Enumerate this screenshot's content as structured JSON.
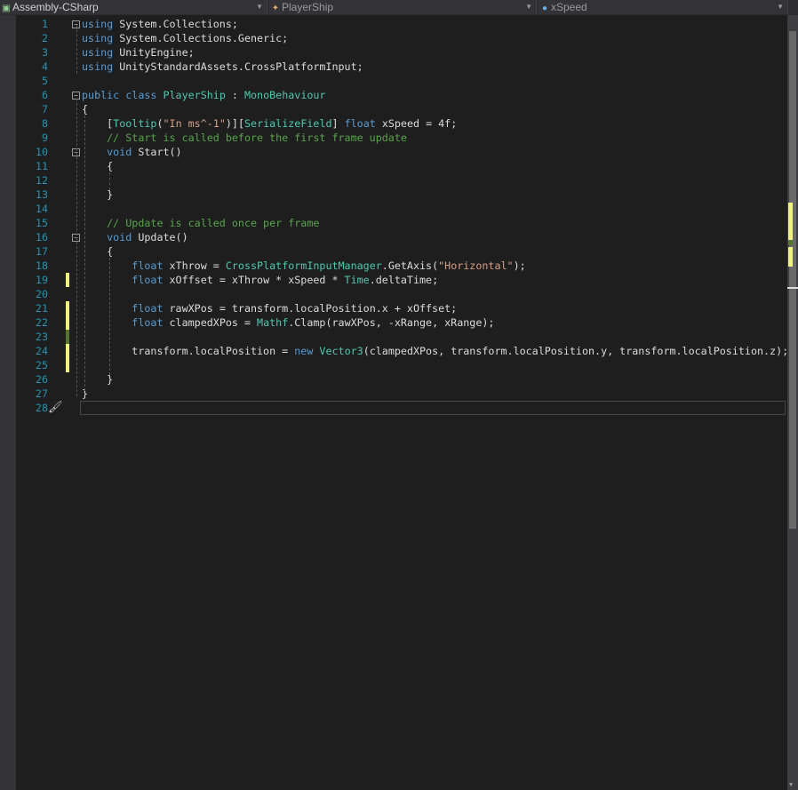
{
  "navbar": {
    "project": "Assembly-CSharp",
    "class": "PlayerShip",
    "member": "xSpeed",
    "project_icon": "csharp-project-icon",
    "class_icon": "class-icon",
    "member_icon": "field-icon"
  },
  "colors": {
    "background": "#1e1e1e",
    "line_number": "#2b91af",
    "keyword": "#569cd6",
    "type": "#4ec9b0",
    "string": "#d69d85",
    "comment": "#57a64a",
    "changed": "#eff283",
    "saved": "#577430"
  },
  "lines": [
    {
      "n": "1",
      "fold": "−",
      "change": "",
      "tokens": [
        [
          "kw",
          "using"
        ],
        [
          "pl",
          " System.Collections;"
        ]
      ]
    },
    {
      "n": "2",
      "fold": "",
      "change": "",
      "tokens": [
        [
          "kw",
          "using"
        ],
        [
          "pl",
          " System.Collections.Generic;"
        ]
      ]
    },
    {
      "n": "3",
      "fold": "",
      "change": "",
      "tokens": [
        [
          "kw",
          "using"
        ],
        [
          "pl",
          " UnityEngine;"
        ]
      ]
    },
    {
      "n": "4",
      "fold": "",
      "change": "",
      "tokens": [
        [
          "kw",
          "using"
        ],
        [
          "pl",
          " UnityStandardAssets.CrossPlatformInput;"
        ]
      ]
    },
    {
      "n": "5",
      "fold": "",
      "change": "",
      "tokens": []
    },
    {
      "n": "6",
      "fold": "−",
      "change": "",
      "tokens": [
        [
          "kw",
          "public class "
        ],
        [
          "ty",
          "PlayerShip"
        ],
        [
          "pl",
          " : "
        ],
        [
          "ty",
          "MonoBehaviour"
        ]
      ]
    },
    {
      "n": "7",
      "fold": "",
      "change": "",
      "tokens": [
        [
          "pl",
          "{"
        ]
      ]
    },
    {
      "n": "8",
      "fold": "",
      "change": "",
      "tokens": [
        [
          "pl",
          "    ["
        ],
        [
          "ty",
          "Tooltip"
        ],
        [
          "pl",
          "("
        ],
        [
          "st",
          "\"In ms^-1\""
        ],
        [
          "pl",
          ")]["
        ],
        [
          "ty",
          "SerializeField"
        ],
        [
          "pl",
          "] "
        ],
        [
          "kw",
          "float"
        ],
        [
          "pl",
          " xSpeed = 4f;"
        ]
      ]
    },
    {
      "n": "9",
      "fold": "",
      "change": "",
      "tokens": [
        [
          "cm",
          "    // Start is called before the first frame update"
        ]
      ]
    },
    {
      "n": "10",
      "fold": "−",
      "change": "",
      "tokens": [
        [
          "kw",
          "    void"
        ],
        [
          "pl",
          " Start()"
        ]
      ]
    },
    {
      "n": "11",
      "fold": "",
      "change": "",
      "tokens": [
        [
          "pl",
          "    {"
        ]
      ]
    },
    {
      "n": "12",
      "fold": "",
      "change": "",
      "tokens": []
    },
    {
      "n": "13",
      "fold": "",
      "change": "",
      "tokens": [
        [
          "pl",
          "    }"
        ]
      ]
    },
    {
      "n": "14",
      "fold": "",
      "change": "",
      "tokens": []
    },
    {
      "n": "15",
      "fold": "",
      "change": "",
      "tokens": [
        [
          "cm",
          "    // Update is called once per frame"
        ]
      ]
    },
    {
      "n": "16",
      "fold": "−",
      "change": "",
      "tokens": [
        [
          "kw",
          "    void"
        ],
        [
          "pl",
          " Update()"
        ]
      ]
    },
    {
      "n": "17",
      "fold": "",
      "change": "",
      "tokens": [
        [
          "pl",
          "    {"
        ]
      ]
    },
    {
      "n": "18",
      "fold": "",
      "change": "",
      "tokens": [
        [
          "kw",
          "        float"
        ],
        [
          "pl",
          " xThrow = "
        ],
        [
          "ty",
          "CrossPlatformInputManager"
        ],
        [
          "pl",
          ".GetAxis("
        ],
        [
          "st",
          "\"Horizontal\""
        ],
        [
          "pl",
          ");"
        ]
      ]
    },
    {
      "n": "19",
      "fold": "",
      "change": "changed",
      "tokens": [
        [
          "kw",
          "        float"
        ],
        [
          "pl",
          " xOffset = xThrow * xSpeed * "
        ],
        [
          "ty",
          "Time"
        ],
        [
          "pl",
          ".deltaTime;"
        ]
      ]
    },
    {
      "n": "20",
      "fold": "",
      "change": "",
      "tokens": []
    },
    {
      "n": "21",
      "fold": "",
      "change": "changed",
      "tokens": [
        [
          "kw",
          "        float"
        ],
        [
          "pl",
          " rawXPos = transform.localPosition.x + xOffset;"
        ]
      ]
    },
    {
      "n": "22",
      "fold": "",
      "change": "changed",
      "tokens": [
        [
          "kw",
          "        float"
        ],
        [
          "pl",
          " clampedXPos = "
        ],
        [
          "ty",
          "Mathf"
        ],
        [
          "pl",
          ".Clamp(rawXPos, -xRange, xRange);"
        ]
      ]
    },
    {
      "n": "23",
      "fold": "",
      "change": "saved",
      "tokens": []
    },
    {
      "n": "24",
      "fold": "",
      "change": "changed",
      "tokens": [
        [
          "pl",
          "        transform.localPosition = "
        ],
        [
          "kw",
          "new"
        ],
        [
          "pl",
          " "
        ],
        [
          "ty",
          "Vector3"
        ],
        [
          "pl",
          "(clampedXPos, transform.localPosition.y, transform.localPosition.z);"
        ]
      ]
    },
    {
      "n": "25",
      "fold": "",
      "change": "changed",
      "tokens": []
    },
    {
      "n": "26",
      "fold": "",
      "change": "",
      "tokens": [
        [
          "pl",
          "    }"
        ]
      ]
    },
    {
      "n": "27",
      "fold": "",
      "change": "",
      "tokens": [
        [
          "pl",
          "}"
        ]
      ]
    },
    {
      "n": "28",
      "fold": "",
      "change": "",
      "tokens": []
    }
  ]
}
